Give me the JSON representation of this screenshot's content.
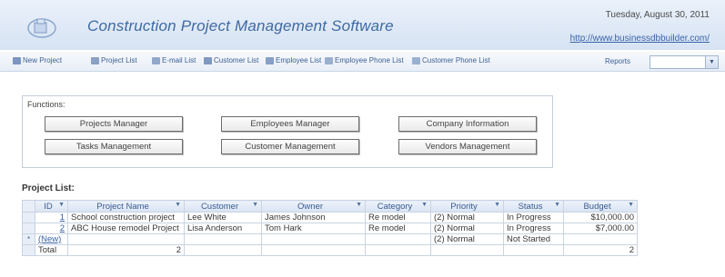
{
  "header": {
    "title": "Construction Project Management Software",
    "date": "Tuesday, August 30, 2011",
    "url": "http://www.businessdbbuilder.com/"
  },
  "toolbar": {
    "items": [
      {
        "label": "New Project",
        "icon": "new-document-icon"
      },
      {
        "label": "Project List",
        "icon": "list-icon"
      },
      {
        "label": "E-mail List",
        "icon": "email-icon"
      },
      {
        "label": "Customer List",
        "icon": "customers-icon"
      },
      {
        "label": "Employee List",
        "icon": "employees-icon"
      },
      {
        "label": "Employee Phone List",
        "icon": "phone-icon"
      },
      {
        "label": "Customer Phone List",
        "icon": "phone-icon"
      }
    ],
    "reports_label": "Reports",
    "reports_value": ""
  },
  "functions": {
    "label": "Functions:",
    "buttons": [
      "Projects Manager",
      "Employees Manager",
      "Company Information",
      "Tasks Management",
      "Customer Management",
      "Vendors Management"
    ]
  },
  "project_list": {
    "label": "Project List:",
    "columns": [
      "ID",
      "Project Name",
      "Customer",
      "Owner",
      "Category",
      "Priority",
      "Status",
      "Budget"
    ],
    "rows": [
      {
        "id": "1",
        "name": "School construction project",
        "customer": "Lee White",
        "owner": "James Johnson",
        "category": "Re model",
        "priority": "(2) Normal",
        "status": "In Progress",
        "budget": "$10,000.00"
      },
      {
        "id": "2",
        "name": "ABC House remodel Project",
        "customer": "Lisa Anderson",
        "owner": "Tom Hark",
        "category": "Re model",
        "priority": "(2) Normal",
        "status": "In Progress",
        "budget": "$7,000.00"
      }
    ],
    "new_row": {
      "marker": "*",
      "id": "(New)",
      "priority": "(2) Normal",
      "status": "Not Started"
    },
    "total": {
      "label": "Total",
      "count": "2",
      "budget": "2"
    }
  },
  "colors": {
    "accent": "#3f6aa3",
    "header_bg": "#dce7f5",
    "grid_border": "#c9d3e2"
  }
}
